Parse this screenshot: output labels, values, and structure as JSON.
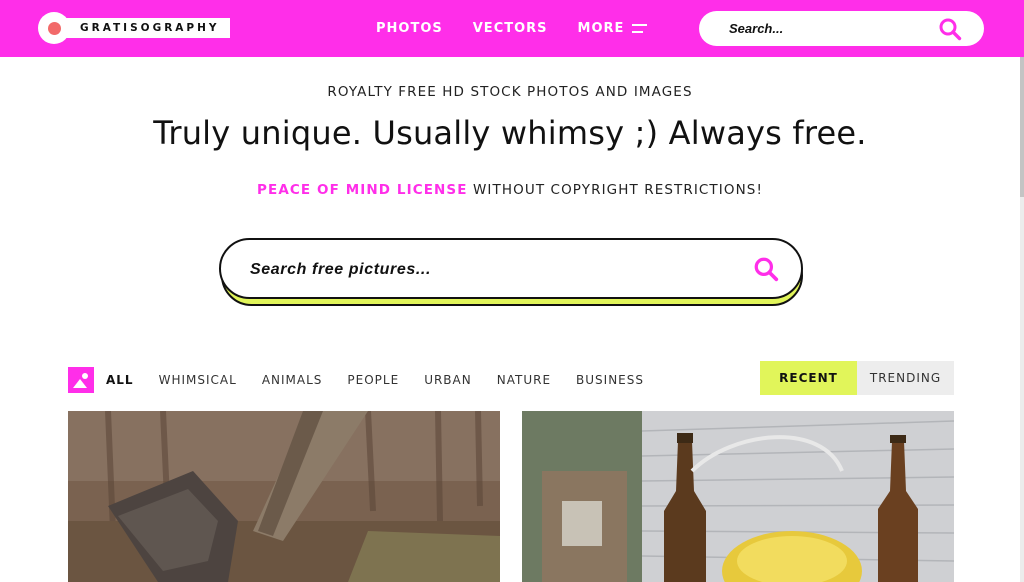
{
  "brand": {
    "name": "GRATISOGRAPHY"
  },
  "nav": {
    "items": [
      "PHOTOS",
      "VECTORS",
      "MORE"
    ]
  },
  "top_search": {
    "placeholder": "Search..."
  },
  "hero": {
    "eyebrow": "ROYALTY FREE HD STOCK PHOTOS AND IMAGES",
    "headline": "Truly unique. Usually whimsy ;) Always free.",
    "license_link": "PEACE OF MIND LICENSE",
    "license_rest": " WITHOUT COPYRIGHT RESTRICTIONS!"
  },
  "main_search": {
    "placeholder": "Search free pictures..."
  },
  "filters": {
    "categories": [
      "ALL",
      "WHIMSICAL",
      "ANIMALS",
      "PEOPLE",
      "URBAN",
      "NATURE",
      "BUSINESS"
    ],
    "active_category": "ALL",
    "sort": [
      "RECENT",
      "TRENDING"
    ],
    "active_sort": "RECENT"
  },
  "colors": {
    "brand_pink": "#ff2ee9",
    "accent_lime": "#e1f55a",
    "logo_dot": "#f26a6a"
  },
  "icons": [
    "search-icon",
    "menu-icon",
    "category-icon"
  ]
}
